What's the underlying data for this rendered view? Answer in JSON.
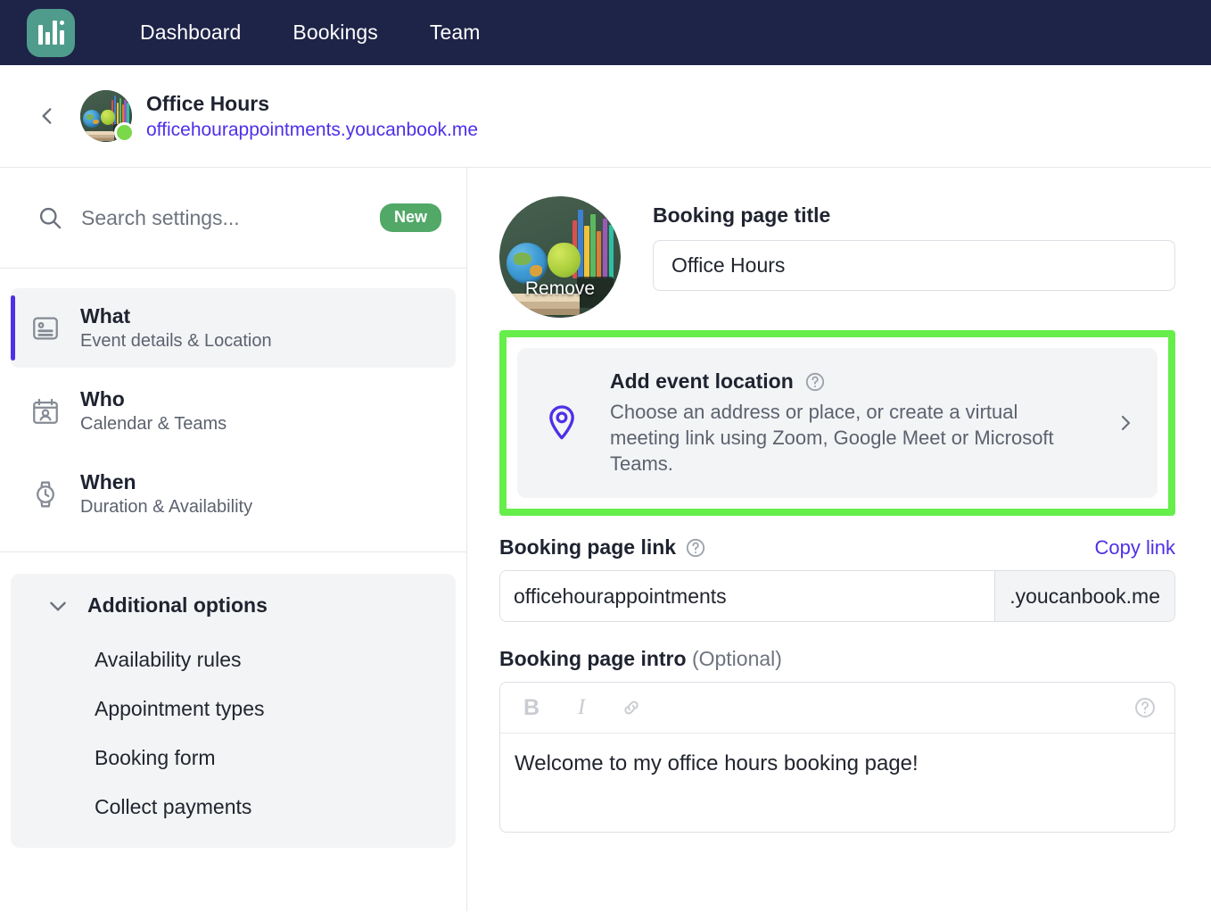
{
  "navbar": {
    "logo_name": "youcanbookme-logo",
    "links": [
      "Dashboard",
      "Bookings",
      "Team"
    ]
  },
  "page_header": {
    "back_icon": "chevron-left-icon",
    "avatar_alt": "classroom-photo-avatar",
    "status": "online",
    "title": "Office Hours",
    "link": "officehourappointments.youcanbook.me"
  },
  "sidebar": {
    "search": {
      "icon": "search-icon",
      "placeholder": "Search settings...",
      "badge": "New"
    },
    "items": [
      {
        "icon": "contact-card-icon",
        "title": "What",
        "subtitle": "Event details & Location",
        "active": true
      },
      {
        "icon": "calendar-person-icon",
        "title": "Who",
        "subtitle": "Calendar & Teams",
        "active": false
      },
      {
        "icon": "watch-icon",
        "title": "When",
        "subtitle": "Duration & Availability",
        "active": false
      }
    ],
    "additional": {
      "chevron": "chevron-down-icon",
      "title": "Additional options",
      "items": [
        "Availability rules",
        "Appointment types",
        "Booking form",
        "Collect payments"
      ]
    }
  },
  "main": {
    "avatar": {
      "alt": "booking-page-photo",
      "remove_label": "Remove"
    },
    "title_field": {
      "label": "Booking page title",
      "value": "Office Hours"
    },
    "location_card": {
      "icon": "map-pin-icon",
      "title": "Add event location",
      "help_icon": "help-circle-icon",
      "description": "Choose an address or place, or create a virtual meeting link using Zoom, Google Meet or Microsoft Teams.",
      "chevron": "chevron-right-icon",
      "highlight_color": "#66ee4a"
    },
    "link_field": {
      "label": "Booking page link",
      "help_icon": "help-circle-icon",
      "copy_label": "Copy link",
      "value": "officehourappointments",
      "suffix": ".youcanbook.me"
    },
    "intro_field": {
      "label": "Booking page intro",
      "optional": "(Optional)",
      "toolbar": [
        "B",
        "I",
        "link-icon"
      ],
      "help_icon": "help-circle-icon",
      "content": "Welcome to my office hours booking page!"
    }
  },
  "colors": {
    "navbar": "#1e2348",
    "accent": "#4f2fe8",
    "badge_green": "#52a867",
    "highlight_green": "#66ee4a",
    "logo_teal": "#4f9c8c"
  }
}
